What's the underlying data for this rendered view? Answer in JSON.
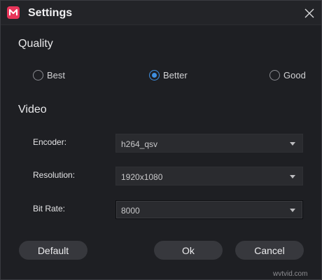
{
  "window": {
    "title": "Settings"
  },
  "quality": {
    "heading": "Quality",
    "options": [
      {
        "label": "Best",
        "checked": false
      },
      {
        "label": "Better",
        "checked": true
      },
      {
        "label": "Good",
        "checked": false
      }
    ]
  },
  "video": {
    "heading": "Video",
    "encoder": {
      "label": "Encoder:",
      "value": "h264_qsv"
    },
    "resolution": {
      "label": "Resolution:",
      "value": "1920x1080"
    },
    "bitrate": {
      "label": "Bit Rate:",
      "value": "8000"
    }
  },
  "buttons": {
    "default_label": "Default",
    "ok_label": "Ok",
    "cancel_label": "Cancel"
  },
  "watermark": "wvtvid.com",
  "colors": {
    "accent": "#3f8fe0",
    "brand": "#e8355a",
    "background": "#1e1f23"
  },
  "icons": {
    "app": "app-logo-icon",
    "close": "close-icon",
    "dropdown": "chevron-down-icon"
  }
}
